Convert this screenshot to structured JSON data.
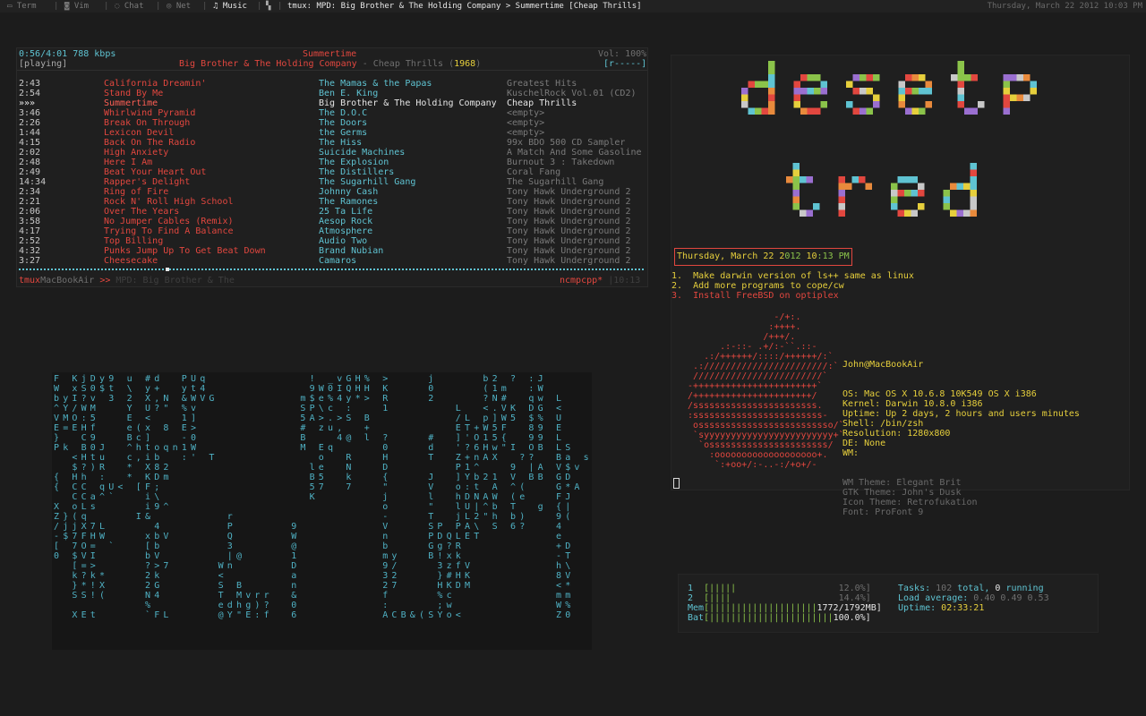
{
  "topbar": {
    "tabs": [
      {
        "icon": "terminal-icon",
        "label": "Term"
      },
      {
        "icon": "gamepad-icon",
        "label": "Vim"
      },
      {
        "icon": "chat-icon",
        "label": "Chat"
      },
      {
        "icon": "network-icon",
        "label": "Net"
      },
      {
        "icon": "music-note-icon",
        "label": "Music"
      }
    ],
    "window_title": "tmux: MPD: Big Brother & The Holding Company > Summertime [Cheap Thrills]",
    "date": "Thursday, March 22 2012 10:03 PM"
  },
  "ncmpcpp": {
    "elapsed": "0:56/4:01 788 kbps",
    "state": "[playing]",
    "now_title": "Summertime",
    "now_artist": "Big Brother & The Holding Company",
    "now_sep": " - ",
    "now_album": "Cheap Thrills",
    "now_year_open": "(",
    "now_year": "1968",
    "now_year_close": ")",
    "volume": "Vol: 100%",
    "flags": "[r-----]",
    "rows": [
      {
        "time": "2:43",
        "title": "California Dreamin'",
        "artist": "The Mamas & the Papas",
        "album": "Greatest Hits"
      },
      {
        "time": "2:54",
        "title": "Stand By Me",
        "artist": "Ben E. King",
        "album": "KuschelRock Vol.01 (CD2)"
      },
      {
        "time": "»»»",
        "title": "Summertime",
        "artist": "Big Brother & The Holding Company",
        "album": "Cheap Thrills"
      },
      {
        "time": "3:46",
        "title": "Whirlwind Pyramid",
        "artist": "The D.O.C",
        "album": "<empty>"
      },
      {
        "time": "2:26",
        "title": "Break On Through",
        "artist": "The Doors",
        "album": "<empty>"
      },
      {
        "time": "1:44",
        "title": "Lexicon Devil",
        "artist": "the Germs",
        "album": "<empty>"
      },
      {
        "time": "4:15",
        "title": "Back On The Radio",
        "artist": "The Hiss",
        "album": "99x BDO 500 CD Sampler"
      },
      {
        "time": "2:02",
        "title": "High Anxiety",
        "artist": "Suicide Machines",
        "album": "A Match And Some Gasoline"
      },
      {
        "time": "2:48",
        "title": "Here I Am",
        "artist": "The Explosion",
        "album": "Burnout 3 : Takedown"
      },
      {
        "time": "2:49",
        "title": "Beat Your Heart Out",
        "artist": "The Distillers",
        "album": "Coral Fang"
      },
      {
        "time": "14:34",
        "title": "Rapper's Delight",
        "artist": "The Sugarhill Gang",
        "album": "The Sugarhill Gang"
      },
      {
        "time": "2:34",
        "title": "Ring of Fire",
        "artist": "Johnny Cash",
        "album": "Tony Hawk Underground 2"
      },
      {
        "time": "2:21",
        "title": "Rock N' Roll High School",
        "artist": "The Ramones",
        "album": "Tony Hawk Underground 2"
      },
      {
        "time": "2:06",
        "title": "Over The Years",
        "artist": "25 Ta Life",
        "album": "Tony Hawk Underground 2"
      },
      {
        "time": "3:58",
        "title": "No Jumper Cables (Remix)",
        "artist": "Aesop Rock",
        "album": "Tony Hawk Underground 2"
      },
      {
        "time": "4:17",
        "title": "Trying To Find A Balance",
        "artist": "Atmosphere",
        "album": "Tony Hawk Underground 2"
      },
      {
        "time": "2:52",
        "title": "Top Billing",
        "artist": "Audio Two",
        "album": "Tony Hawk Underground 2"
      },
      {
        "time": "4:32",
        "title": "Punks Jump Up To Get Beat Down",
        "artist": "Brand Nubian",
        "album": "Tony Hawk Underground 2"
      },
      {
        "time": "3:27",
        "title": "Cheesecake",
        "artist": "Camaros",
        "album": "Tony Hawk Underground 2"
      }
    ],
    "current_index": 2,
    "status_left_a": "tmux",
    "status_left_b": "MacBookAir",
    "status_left_c": " >> ",
    "status_left_d": "MPD: Big Brother & The",
    "status_right_a": "ncmpcpp*",
    "status_right_b": " |10:13"
  },
  "right": {
    "logo_line1": "desetp",
    "logo_line2": "tred",
    "clock_day": "Thursday, March 22 2",
    "clock_hi": "012",
    "clock_rest_a": " 10",
    "clock_rest_b": ":13 PM",
    "todos": [
      {
        "num": "1.",
        "text": "Make darwin version of ls++ same as linux",
        "color": "#e6cf3c"
      },
      {
        "num": "2.",
        "text": "Add more programs to cope/cw",
        "color": "#e6cf3c"
      },
      {
        "num": "3.",
        "text": "Install FreeBSD on optiplex",
        "color": "#e2473f"
      }
    ],
    "ascii_art": "                  -/+:.\n                 :++++.\n                /+++/.\n        .:-::- .+/:-``.::-\n     .:/++++++/::::/++++++/:`\n   .:///////////////////////:`\n   ////////////////////////`\n  -+++++++++++++++++++++++`\n  /++++++++++++++++++++++/\n  /sssssssssssssssssssssss.\n  :ssssssssssssssssssssssss-\n   osssssssssssssssssssssssso/`\n   `syyyyyyyyyyyyyyyyyyyyyyyy+`\n    `ossssssssssssssssssssss/\n      :ooooooooooooooooooo+.\n       `:+oo+/:-..-:/+o+/-",
    "sys_user": "John@MacBookAir",
    "sys": [
      {
        "k": "OS:",
        "v": "Mac OS X 10.6.8 10K549 OS X i386"
      },
      {
        "k": "Kernel:",
        "v": "Darwin 10.8.0 i386"
      },
      {
        "k": "Uptime:",
        "v": "Up 2 days, 2 hours and users minutes"
      },
      {
        "k": "Shell:",
        "v": "/bin/zsh"
      },
      {
        "k": "Resolution:",
        "v": "1280x800"
      },
      {
        "k": "DE:",
        "v": "None"
      },
      {
        "k": "WM:",
        "v": ""
      }
    ],
    "sys_dim": [
      {
        "k": "WM Theme:",
        "v": "Elegant Brit"
      },
      {
        "k": "GTK Theme:",
        "v": "John's Dusk"
      },
      {
        "k": "Icon Theme:",
        "v": "Retrofukation"
      },
      {
        "k": "Font:",
        "v": "ProFont 9"
      }
    ]
  },
  "htop": {
    "cpu1_label": "1",
    "cpu1_bar": "[|||||",
    "cpu1_val": "12.0%]",
    "cpu2_label": "2",
    "cpu2_bar": "[||||",
    "cpu2_val": "14.4%]",
    "mem_label": "Mem",
    "mem_bar": "[||||||||||||||||||||",
    "mem_val": "1772/1792MB]",
    "bat_label": "Bat",
    "bat_bar": "[|||||||||||||||||||||||",
    "bat_val": "100.0%]",
    "tasks_k": "Tasks: ",
    "tasks_a": "102",
    "tasks_b": " total, ",
    "tasks_c": "0",
    "tasks_d": " running",
    "load_k": "Load average: ",
    "load_v": "0.40 0.49 0.53",
    "uptime_k": "Uptime: ",
    "uptime_v": "02:33:21"
  },
  "matrix_columns": [
    "F\nW\nb\n^\nV\nE\n}\nP\n \n \n{\n{\n \nX\nZ\n/\n-\n[\n0",
    " \n \ny\nY\nM\n=\n \nk\n \n \n \n \n \n \n}\nj\n$\n \n \n \n \n \n ",
    "K\nx\nI\n/\nO\nE\n \n \n<\n$\nH\nC\nC\no\n(\nj\n7\n7\n$\n[\nk\n}\nS\n \nX",
    "j\nS\n?\nW\n:\nH\nC\nB\nH\n?\nh\nC\nC\nL\nq\nX\nF\nO\nV\n=\n?\n*\nS\n \nE",
    "D\n0\nv\nM\n5\nf\n9\n0\nt\n)\n \n \na\ns\n \n7\nH\n=\nI\n>\nk\n!\n!\n \nt",
    "y\n$\n \n \n \n \n \nJ\nu\nR\n:\nq\n^\n \n \nL\nW\n \n \n \n*\nX\n(\n \n ",
    "9\nt\n3\n \n \n \n \n \n \n \n \nU\n`\n \n \n \n \n` \n \n \n \n \n \n \n ",
    " \n \n \n \n \n \n \n \n \n \n \n<\n \n \n \n \n \n \n \n \n \n \n \n \n ",
    "u\n\\\n2\nY\nE\ne\nB\n^\nc\n*\n*\n \n \n \n \n \n \n \n \n \n \n \n \n \n ",
    " \n \n \n \n \n(\nc\nh\n,\n \n \n[\n \n \nI\n \n \n \n \n \n \n \n \n \n ",
    "#\ny\nX\nU\n<\nx\n]\nt\ni\nX\nK\nF\ni\ni\n&\n \nx\n[\nb\n?\n2\n2\nN\n%\n`",
    "d\n+\n,\n?\n \n \n \no\nb\n8\nD\n;\n\\\n9\n \n4\nb\nb\nV\n>\nk\nG\n4\n \nF",
    " \n \nN\n\"\n \n8\n \nq\n \n2\nm\n \n \n^\n \n \nV\n \n \n7\n \n \n \n \nL",
    " \n \n \n \n \n \n \nn\n \n \n \n \n \n \n \n \n \n \n \n \n \n \n \n \n ",
    "P\ny\n&\n%\n1\nE\n-\n1\n:\n \n \n \n \n \n \n \n \n \n \n \n \n \n \n \n ",
    "U\nt\nW\nv\n]\n>\n0\nW\n'\n \n \n \n \n \n \n \n \n \n \n \n \n \n \n \n ",
    "q\n4\nV\n \n \n \n \n \n \n \n \n \n \n \n \n \n \n \n \n \n \n \n \n \n ",
    " \n \nG\n \n \n \n \n \nT\n \n \n \n \n \n \n \n \n \n \n \n \n \n \n \n ",
    " \n \n \n \n \n \n \n \n \n \n \n \n \n \n \n \n \n \n \nW\n<\nS\nT\ne\n@",
    " \n \n \n \n \n \n \n \n \n \n \n \n \n \nr\nP\nQ\n3\n|\nn\n \n \n \nd\nY",
    " \n \n \n \n \n \n \n \n \n \n \n \n \n \n \n \n \n \n@\n \n \nB\nM\nh\n\"",
    " \n \n \n \n \n \n \n \n \n \n \n \n \n \n \n \n \n \n \n \n \n \nv\ng\nE",
    " \n \n \n \n \n \n \n \n \n \n \n \n \n \n \n \n \n \n \n \n \n \nr\n)\n:",
    " \n \n \n \n \n \n \n \n \n \n \n \n \n \n \n \n \n \n \n \n \n \nr\n?\nf",
    " \n \n \n \n \n \n \n \n \n \n \n \n \n \n \n \n \n \n \n \n \n \n \n \n ",
    " \n \n \n \n \n \n \n \n \n \n \n \n \n \n \n \n \n \n \n \n \n \n \n \n ",
    " \n \n \n \n \n \n \n \n \n \n \n \n \n \n \n9\nW\n@\n1\nD\na\nn\n&\n0\n6",
    " \n \nm\nS\n5\n#\nB\nM\n \n \n \n \n \n \n \n \n \n \n \n \n \n \n \n \n ",
    "!\n9\n$\nP\nA\n \n \n \n \nl\nB\n5\nK\n \n \n \n \n \n \n \n \n \n \n \n ",
    " \nW\ne\n\\\n>\nz\n \nE\no\ne\n5\n7\n \n \n \n \n \n \n \n \n \n \n \n \n ",
    "_\n0\n%\nc\n.\nu\n \nq\n \n \n \n \n \n \n \n \n \n \n \n \n \n \n \n \n ",
    "v\nI\n4\n \n>\n,\n4\n \n \n \n \n \n \n \n \n \n \n \n \n \n \n \n \n \n ",
    "G\nQ\ny\n:\nS\n \n@\n \nR\nN\nk\n7\n \n \n \n \n \n \n \n \n \n \n \n \n ",
    "H\nH\n*\n \n \n \n \n \n \n \n \n \n \n \n \n \n \n \n \n \n \n \n \n \n ",
    "%\nH\n>\n \nB\n+\nl\n \n \n \n \n \n \n \n \n \n \n \n \n \n \n \n \n \n ",
    " \n \n \n \n \n \n \n \n \n \n \n \n \n \n \n \n \n \n \n \n \n \n \n \n ",
    ">\nK\nR\n1\n \n \n?\n0\nH\nD\n{\n\"\nj\no\n-\nV\nn\nb\nm\n9\n3\n2\nf\n:\nA",
    " \n \n \n \n \n \n \n \n \n \n \n \n \n \n \n \n \n \ny\n/\n2\n7\n \n \nC",
    " \n \n \n \n \n \n \n \n \n \n \n \n \n \n \n \n \n \n \n \n \n \n \n \nB",
    " \n \n \n \n \n \n \n \n \n \n \n \n \n \n \n \n \n \n \n \n \n \n \n \n&",
    " \n \n \n \n \n \n \n \n \n \n \n \n \n \n \n \n \n \n \n \n \n \n \n \n(",
    "j\n0\n2\n \n \n \n#\nd\nT\n \nJ\nV\nl\n\"\nT\nS\nP\nG\nB\n \n \n \n \n \nS",
    " \n \n \n \n \n \n \n \n \n \n \n \n \n \n \nP\nD\ng\n!\n3\n}\nH\n%\n;\nY",
    " \n \n \n \n \n \n \n \n \n \n \n \n \n \n \n \nQ\n?\nx\nz\n#\nK\nc\nw\no",
    " \n \n \nL\n/\nE\n]\n'\nZ\nP\n]\no\nh\nl\nj\nP\nL\nR\nk\nf\nH\nD\n \n \n<",
    " \n \n \n \nL\nT\n'\n?\n+\n1\nY\n:\nD\nU\nL\nA\nE\n \n \nV\nK\nM\n \n \n ",
    " \n \n \n \n \n+\nO\n6\nn\n^\nb\nt\nN\n|\n2\n\\\nT\n \n \n \n \n \n \n \n ",
    "b\n(\n?\n<\np\nW\n1\nH\nA\n \n2\n \nA\n^\n\"\n \n \n \n \n \n \n \n \n \n ",
    "2\n1\nN\n.\n]\n5\n5\nw\nX\n \n1\nA\nW\nb\nh\nS\n \n \n \n \n \n \n \n \n ",
    " \nm\n#\nV\nW\nF\n{\n\"\n \n \n \n \n \n \n \n \n \n \n \n \n \n \n \n \n ",
    "?\n \n \nK\n5\n \n \nI\n \n9\nV\n^\n(\nT\nb\n6\n \n \n \n \n \n \n \n \n ",
    " \n \n \n \n \n \n \n \n?\n \n \n(\ne\n \n)\n?\n \n \n \n \n \n \n \n \n ",
    ":\n:\nq\nD\n$\n8\n9\nO\n?\n|\nB\n \n \n \n \n \n \n \n \n \n \n \n \n \n ",
    "J\nW\nw\nG\n%\n9\n9\nB\n \nA\nB\n \n \ng\n \n \n \n \n \n \n \n \n \n \n ",
    " \n \n \n \n \n \n \n \n \n \n \n \n \n \n \n \n \n \n \n \n \n \n \n \n ",
    " \n \nL\n<\nU\nE\nL\nL\nB\nV\nG\nG\nF\n{\n9\n4\ne\n+\n-\nh\n8\n<\nm\nW\nZ",
    " \n \n \n \n \n \n \nS\na\n$\nD\n*\nJ\n|\n(\n \n \nD\nT\n\\\nV\n*\nm\n%\n0",
    " \n \n \n \n \n \n \n \n \nv\n \nA\n \n \n \n \n \n \n \n \n \n \n \n \n ",
    " \n \n \n \n \n \n \n \ns\n \n \n \n \n \n \n \n \n \n \n \n \n \n \n \n "
  ]
}
